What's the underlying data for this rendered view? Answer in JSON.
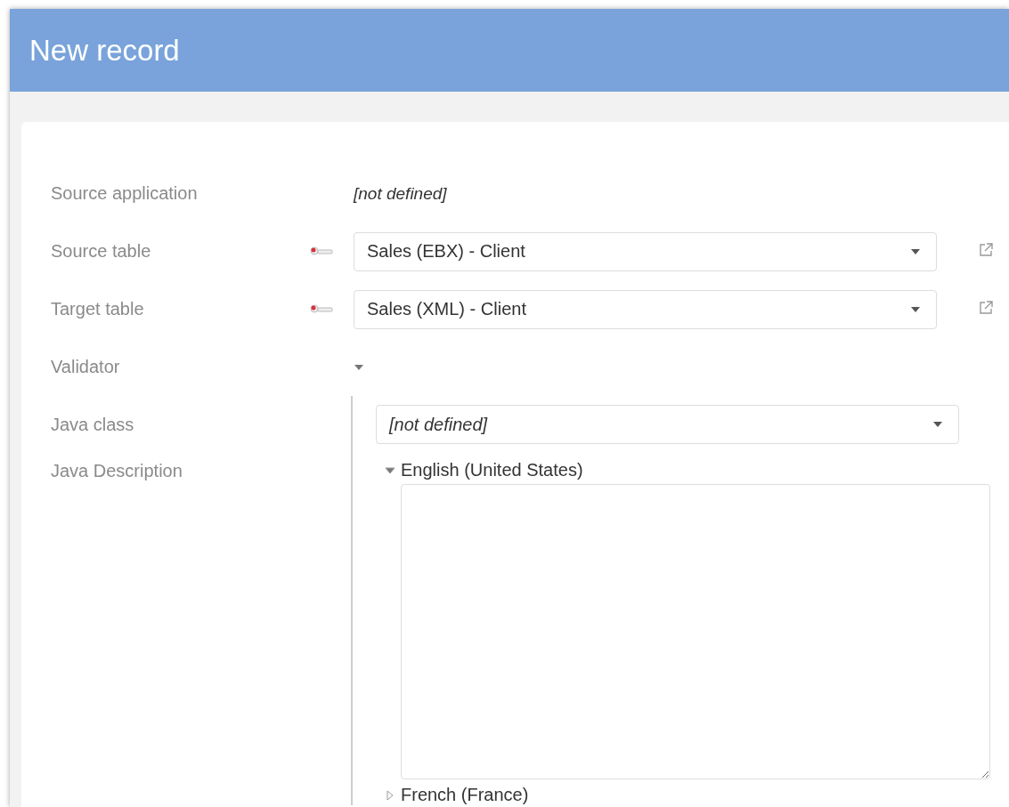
{
  "window": {
    "title": "New record"
  },
  "fields": [
    {
      "kind": "readonly",
      "label": "Source application",
      "value": "[not defined]"
    },
    {
      "kind": "select",
      "label": "Source table",
      "value": "Sales (EBX) - Client",
      "required": true
    },
    {
      "kind": "select",
      "label": "Target table",
      "value": "Sales (XML) - Client",
      "required": true
    },
    {
      "kind": "group",
      "label": "Validator",
      "expanded": true,
      "children": [
        {
          "kind": "select",
          "label": "Java class",
          "value": "[not defined]",
          "undefined": true
        },
        {
          "kind": "localized",
          "label": "Java Description",
          "languages": [
            {
              "name": "English (United States)",
              "expanded": true
            },
            {
              "name": "French (France)",
              "expanded": false
            }
          ]
        }
      ]
    }
  ]
}
